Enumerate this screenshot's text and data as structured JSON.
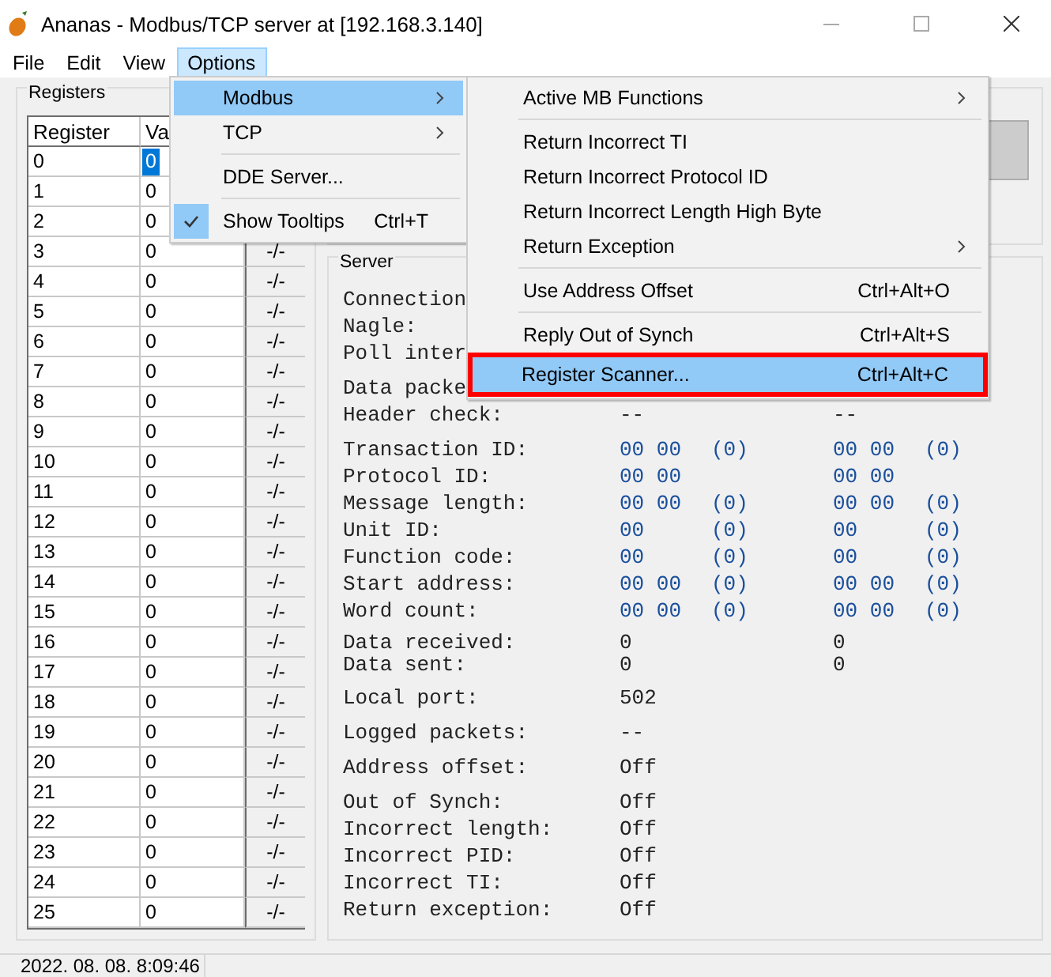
{
  "window": {
    "title": "Ananas - Modbus/TCP server at [192.168.3.140]"
  },
  "menu_bar": [
    {
      "label": "File",
      "selected": false
    },
    {
      "label": "Edit",
      "selected": false
    },
    {
      "label": "View",
      "selected": false
    },
    {
      "label": "Options",
      "selected": true
    }
  ],
  "options_menu": [
    {
      "kind": "item",
      "label": "Modbus",
      "selected": true,
      "checked": false,
      "submenu": true
    },
    {
      "kind": "item",
      "label": "TCP",
      "selected": false,
      "checked": false,
      "submenu": true
    },
    {
      "kind": "separator"
    },
    {
      "kind": "item",
      "label": "DDE Server...",
      "selected": false,
      "checked": false,
      "submenu": false
    },
    {
      "kind": "separator"
    },
    {
      "kind": "item",
      "label": "Show Tooltips",
      "shortcut": "Ctrl+T",
      "selected": false,
      "checked": true,
      "submenu": false
    }
  ],
  "modbus_menu": [
    {
      "kind": "item",
      "label": "Active MB Functions",
      "selected": false,
      "submenu": true,
      "highlighted": false
    },
    {
      "kind": "separator"
    },
    {
      "kind": "item",
      "label": "Return Incorrect TI",
      "selected": false,
      "submenu": false,
      "highlighted": false
    },
    {
      "kind": "item",
      "label": "Return Incorrect Protocol ID",
      "selected": false,
      "submenu": false,
      "highlighted": false
    },
    {
      "kind": "item",
      "label": "Return Incorrect Length High Byte",
      "selected": false,
      "submenu": false,
      "highlighted": false
    },
    {
      "kind": "item",
      "label": "Return Exception",
      "selected": false,
      "submenu": true,
      "highlighted": false
    },
    {
      "kind": "separator"
    },
    {
      "kind": "item",
      "label": "Use Address Offset",
      "shortcut": "Ctrl+Alt+O",
      "selected": false,
      "submenu": false,
      "highlighted": false
    },
    {
      "kind": "separator"
    },
    {
      "kind": "item",
      "label": "Reply Out of Synch",
      "shortcut": "Ctrl+Alt+S",
      "selected": false,
      "submenu": false,
      "highlighted": false
    },
    {
      "kind": "item",
      "label": "Register Scanner...",
      "shortcut": "Ctrl+Alt+C",
      "selected": true,
      "submenu": false,
      "highlighted": true
    }
  ],
  "registers": {
    "title": "Registers",
    "columns": [
      "Register",
      "Va"
    ],
    "rows": [
      {
        "register": "0",
        "value": "0",
        "selected": true
      },
      {
        "register": "1",
        "value": "0",
        "selected": false
      },
      {
        "register": "2",
        "value": "0",
        "selected": false
      },
      {
        "register": "3",
        "value": "0",
        "column_3": "-/-",
        "selected": false
      },
      {
        "register": "4",
        "value": "0",
        "column_3": "-/-",
        "selected": false
      },
      {
        "register": "5",
        "value": "0",
        "column_3": "-/-",
        "selected": false
      },
      {
        "register": "6",
        "value": "0",
        "column_3": "-/-",
        "selected": false
      },
      {
        "register": "7",
        "value": "0",
        "column_3": "-/-",
        "selected": false
      },
      {
        "register": "8",
        "value": "0",
        "column_3": "-/-",
        "selected": false
      },
      {
        "register": "9",
        "value": "0",
        "column_3": "-/-",
        "selected": false
      },
      {
        "register": "10",
        "value": "0",
        "column_3": "-/-",
        "selected": false
      },
      {
        "register": "11",
        "value": "0",
        "column_3": "-/-",
        "selected": false
      },
      {
        "register": "12",
        "value": "0",
        "column_3": "-/-",
        "selected": false
      },
      {
        "register": "13",
        "value": "0",
        "column_3": "-/-",
        "selected": false
      },
      {
        "register": "14",
        "value": "0",
        "column_3": "-/-",
        "selected": false
      },
      {
        "register": "15",
        "value": "0",
        "column_3": "-/-",
        "selected": false
      },
      {
        "register": "16",
        "value": "0",
        "column_3": "-/-",
        "selected": false
      },
      {
        "register": "17",
        "value": "0",
        "column_3": "-/-",
        "selected": false
      },
      {
        "register": "18",
        "value": "0",
        "column_3": "-/-",
        "selected": false
      },
      {
        "register": "19",
        "value": "0",
        "column_3": "-/-",
        "selected": false
      },
      {
        "register": "20",
        "value": "0",
        "column_3": "-/-",
        "selected": false
      },
      {
        "register": "21",
        "value": "0",
        "column_3": "-/-",
        "selected": false
      },
      {
        "register": "22",
        "value": "0",
        "column_3": "-/-",
        "selected": false
      },
      {
        "register": "23",
        "value": "0",
        "column_3": "-/-",
        "selected": false
      },
      {
        "register": "24",
        "value": "0",
        "column_3": "-/-",
        "selected": false
      },
      {
        "register": "25",
        "value": "0",
        "column_3": "-/-",
        "selected": false
      }
    ]
  },
  "server": {
    "title": "Server",
    "sections": [
      {
        "kind": "plain",
        "rows": [
          {
            "label": "Connection"
          },
          {
            "label": "Nagle:"
          },
          {
            "label": "Poll inter"
          }
        ]
      },
      {
        "kind": "plain",
        "rows": [
          {
            "label": "Data packe"
          },
          {
            "label": "Header check:",
            "column_2": "--",
            "column_4": "--"
          }
        ]
      },
      {
        "kind": "packet",
        "rows": [
          {
            "label": "Transaction ID:",
            "column_2": "00 00",
            "column_3": "(0)",
            "column_4": "00 00",
            "column_5": "(0)"
          },
          {
            "label": "Protocol ID:",
            "column_2": "00 00",
            "column_4": "00 00"
          },
          {
            "label": "Message length:",
            "column_2": "00 00",
            "column_3": "(0)",
            "column_4": "00 00",
            "column_5": "(0)"
          },
          {
            "label": "Unit ID:",
            "column_2": "00",
            "column_3": "(0)",
            "column_4": "00",
            "column_5": "(0)"
          },
          {
            "label": "Function code:",
            "column_2": "00",
            "column_3": "(0)",
            "column_4": "00",
            "column_5": "(0)"
          },
          {
            "label": "Start address:",
            "column_2": "00 00",
            "column_3": "(0)",
            "column_4": "00 00",
            "column_5": "(0)"
          },
          {
            "label": "Word count:",
            "column_2": "00 00",
            "column_3": "(0)",
            "column_4": "00 00",
            "column_5": "(0)"
          }
        ]
      },
      {
        "kind": "tight",
        "rows": [
          {
            "label": "Data received:",
            "column_2": "0",
            "column_4": "0"
          },
          {
            "label": "Data sent:",
            "column_2": "0",
            "column_4": "0"
          }
        ]
      },
      {
        "kind": "plain",
        "rows": [
          {
            "label": "Local port:",
            "column_2": "502"
          }
        ]
      },
      {
        "kind": "plain",
        "rows": [
          {
            "label": "Logged packets:",
            "column_2": "--"
          }
        ]
      },
      {
        "kind": "plain",
        "rows": [
          {
            "label": "Address offset:",
            "column_2": "Off"
          }
        ]
      },
      {
        "kind": "plain",
        "rows": [
          {
            "label": "Out of Synch:",
            "column_2": "Off"
          },
          {
            "label": "Incorrect length:",
            "column_2": "Off"
          },
          {
            "label": "Incorrect PID:",
            "column_2": "Off"
          },
          {
            "label": "Incorrect TI:",
            "column_2": "Off"
          },
          {
            "label": "Return exception:",
            "column_2": "Off"
          }
        ]
      }
    ]
  },
  "status_bar": {
    "time": "2022. 08. 08. 8:09:46"
  }
}
